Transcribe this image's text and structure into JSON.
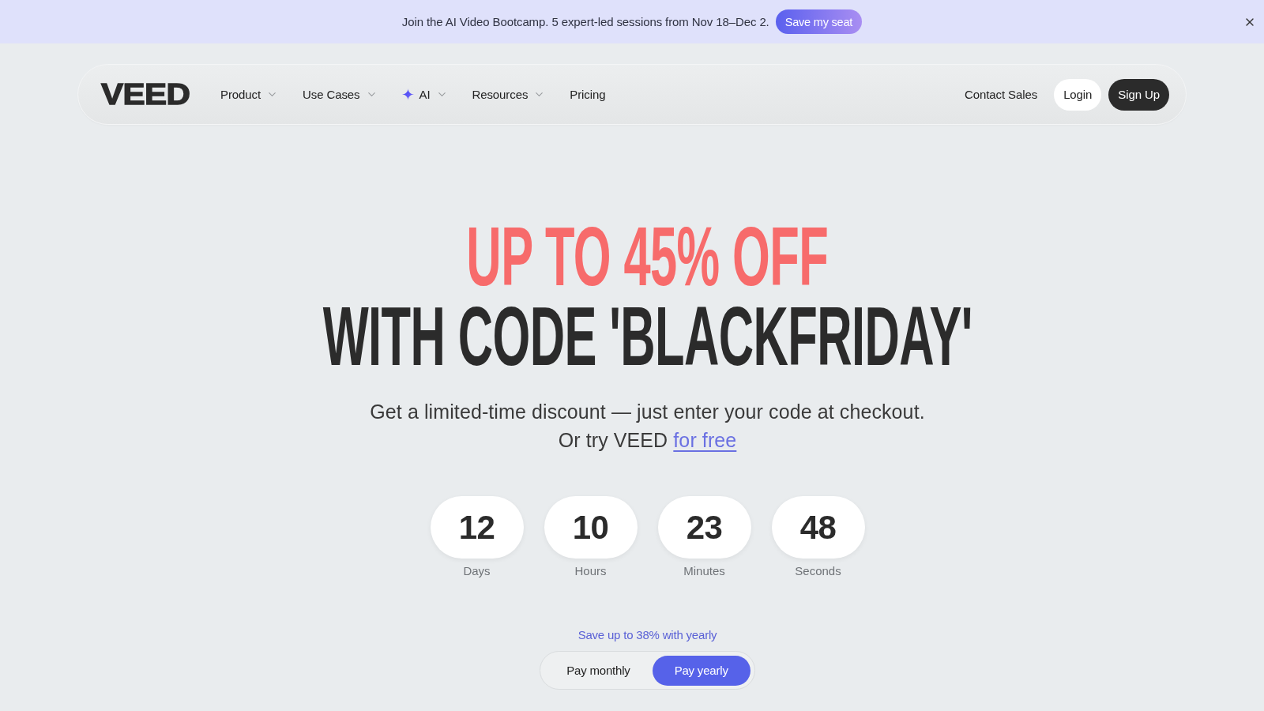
{
  "banner": {
    "text": "Join the AI Video Bootcamp. 5 expert-led sessions from Nov 18–Dec 2.",
    "button": "Save my seat"
  },
  "nav": {
    "logo": "VEED",
    "items": [
      {
        "label": "Product",
        "kind": "menu"
      },
      {
        "label": "Use Cases",
        "kind": "menu"
      },
      {
        "label": "AI",
        "kind": "featured"
      },
      {
        "label": "Resources",
        "kind": "menu"
      },
      {
        "label": "Pricing",
        "kind": "link"
      }
    ],
    "actions": [
      {
        "label": "Contact Sales",
        "kind": "link"
      },
      {
        "label": "Login",
        "kind": "secondary"
      },
      {
        "label": "Sign Up",
        "kind": "primary"
      }
    ]
  },
  "hero": {
    "headline": [
      {
        "text": "UP TO 45% OFF",
        "kind": "accent"
      },
      {
        "text": "WITH CODE 'BLACKFRIDAY'",
        "kind": "plain"
      }
    ],
    "subtitle": "Get a limited-time discount — just enter your code at checkout.",
    "trial": {
      "text": "Or try VEED",
      "link": "for free"
    }
  },
  "countdown": [
    {
      "value": "12",
      "unit": "Days"
    },
    {
      "value": "10",
      "unit": "Hours"
    },
    {
      "value": "23",
      "unit": "Minutes"
    },
    {
      "value": "48",
      "unit": "Seconds"
    }
  ],
  "billing": {
    "note": "Save up to 38% with yearly",
    "options": [
      {
        "label": "Pay monthly",
        "selected": false
      },
      {
        "label": "Pay yearly",
        "selected": true
      }
    ]
  }
}
